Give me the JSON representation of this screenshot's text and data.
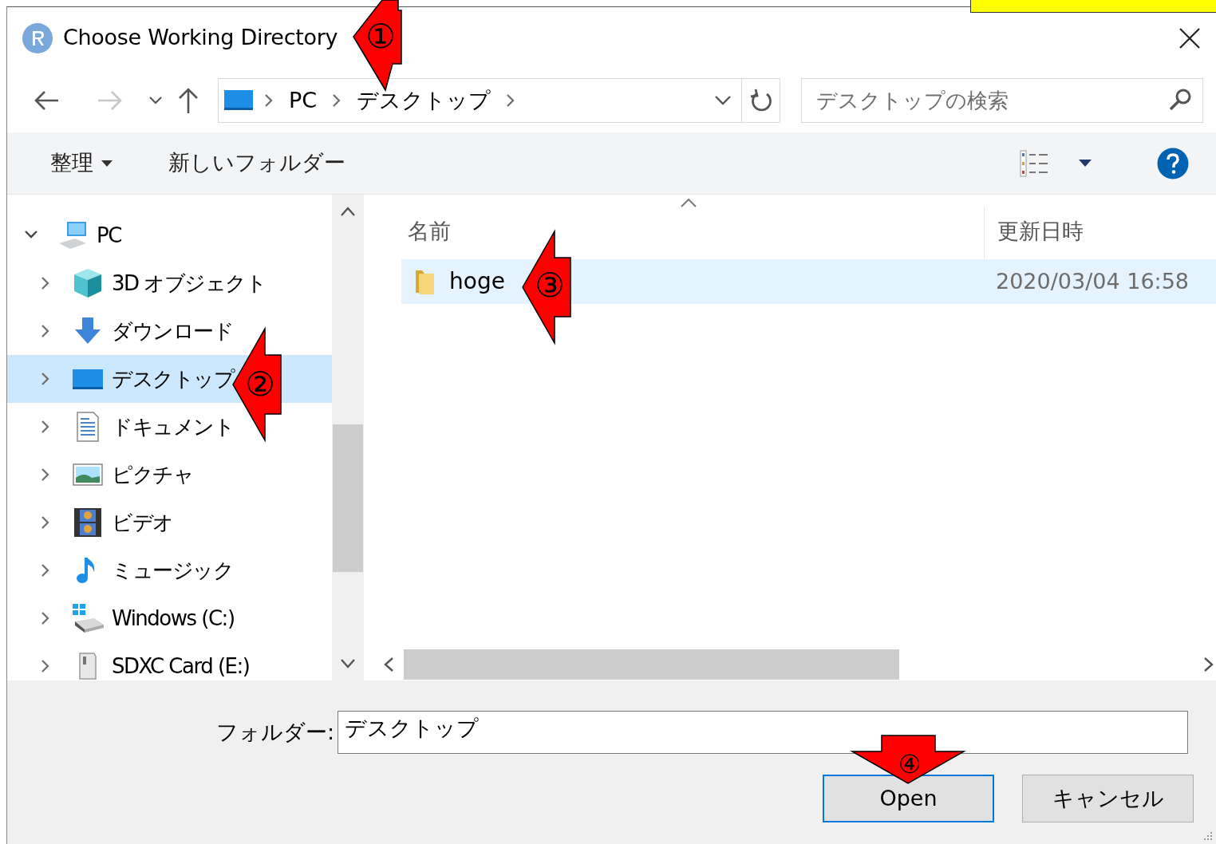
{
  "window": {
    "title": "Choose Working Directory"
  },
  "history": {
    "back": {
      "disabled": false
    },
    "forward": {
      "disabled": true
    }
  },
  "address": {
    "segments": [
      "PC",
      "デスクトップ"
    ]
  },
  "search": {
    "placeholder": "デスクトップの検索"
  },
  "toolbar": {
    "organize": "整理",
    "new_folder": "新しいフォルダー"
  },
  "navigation": {
    "items": [
      {
        "label": "PC",
        "kind": "pc",
        "expanded": true,
        "selected": false,
        "children": [
          {
            "label": "3D オブジェクト",
            "kind": "objects",
            "expanded": false,
            "selected": false
          },
          {
            "label": "ダウンロード",
            "kind": "download",
            "expanded": false,
            "selected": false
          },
          {
            "label": "デスクトップ",
            "kind": "desktop",
            "expanded": false,
            "selected": true
          },
          {
            "label": "ドキュメント",
            "kind": "document",
            "expanded": false,
            "selected": false
          },
          {
            "label": "ピクチャ",
            "kind": "pictures",
            "expanded": false,
            "selected": false
          },
          {
            "label": "ビデオ",
            "kind": "video",
            "expanded": false,
            "selected": false
          },
          {
            "label": "ミュージック",
            "kind": "music",
            "expanded": false,
            "selected": false
          },
          {
            "label": "Windows (C:)",
            "kind": "drive",
            "expanded": false,
            "selected": false
          },
          {
            "label": "SDXC Card (E:)",
            "kind": "card",
            "expanded": false,
            "selected": false
          }
        ]
      }
    ]
  },
  "columns": [
    {
      "label": "名前",
      "sorted": true
    },
    {
      "label": "更新日時",
      "sorted": false
    }
  ],
  "files": [
    {
      "name": "hoge",
      "modified": "2020/03/04 16:58",
      "kind": "folder",
      "selected": true
    }
  ],
  "folder_field": {
    "label": "フォルダー:",
    "value": "デスクトップ"
  },
  "buttons": [
    {
      "label": "Open",
      "default": true
    },
    {
      "label": "キャンセル",
      "default": false
    }
  ],
  "callouts": [
    {
      "label": "①",
      "kind": "left-down"
    },
    {
      "label": "②",
      "kind": "left"
    },
    {
      "label": "③",
      "kind": "left"
    },
    {
      "label": "④",
      "kind": "down"
    }
  ]
}
